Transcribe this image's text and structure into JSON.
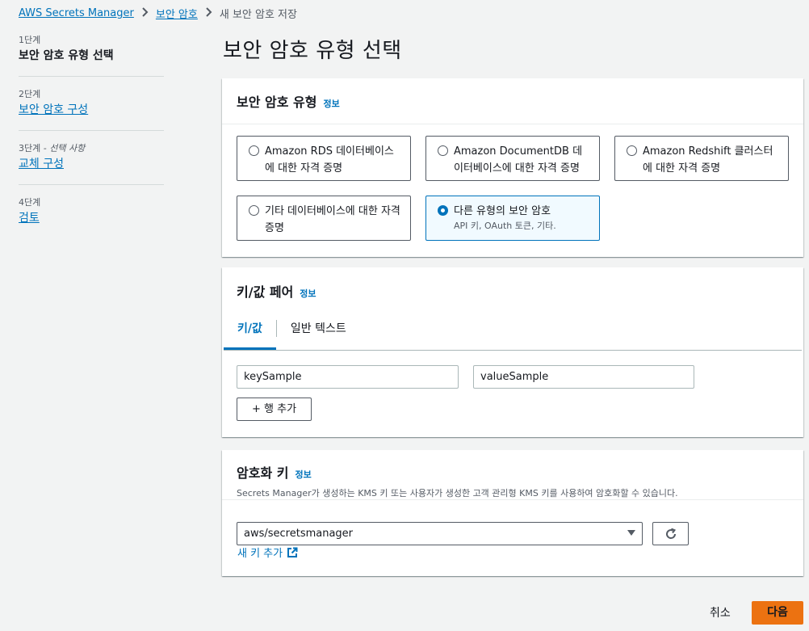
{
  "breadcrumb": {
    "items": [
      "AWS Secrets Manager",
      "보안 암호"
    ],
    "current": "새 보안 암호 저장"
  },
  "steps": [
    {
      "num": "1단계",
      "title": "보안 암호 유형 선택"
    },
    {
      "num": "2단계",
      "title": "보안 암호 구성"
    },
    {
      "num": "3단계",
      "optional": " - 선택 사항",
      "title": "교체 구성"
    },
    {
      "num": "4단계",
      "title": "검토"
    }
  ],
  "page_title": "보안 암호 유형 선택",
  "secret_type": {
    "title": "보안 암호 유형",
    "info": "정보",
    "options": [
      {
        "label": "Amazon RDS 데이터베이스에 대한 자격 증명",
        "selected": false
      },
      {
        "label": "Amazon DocumentDB 데이터베이스에 대한 자격 증명",
        "selected": false
      },
      {
        "label": "Amazon Redshift 클러스터에 대한 자격 증명",
        "selected": false
      },
      {
        "label": "기타 데이터베이스에 대한 자격 증명",
        "selected": false
      },
      {
        "label": "다른 유형의 보안 암호",
        "sub": "API 키, OAuth 토큰, 기타.",
        "selected": true
      }
    ]
  },
  "kv": {
    "title": "키/값 페어",
    "info": "정보",
    "tabs": [
      "키/값",
      "일반 텍스트"
    ],
    "key_value": "keySample",
    "value_value": "valueSample",
    "add_row": "+ 행 추가"
  },
  "encryption": {
    "title": "암호화 키",
    "info": "정보",
    "description": "Secrets Manager가 생성하는 KMS 키 또는 사용자가 생성한 고객 관리형 KMS 키를 사용하여 암호화할 수 있습니다.",
    "selected_key": "aws/secretsmanager",
    "new_key": "새 키 추가"
  },
  "footer": {
    "cancel": "취소",
    "next": "다음"
  },
  "colors": {
    "accent": "#0073bb",
    "primary_button": "#ec7211"
  }
}
